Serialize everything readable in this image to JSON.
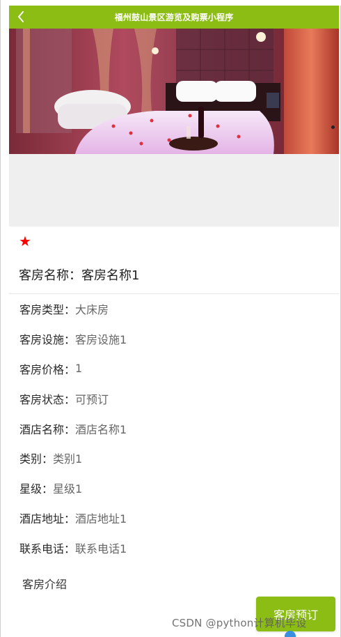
{
  "nav": {
    "title": "福州鼓山景区游览及购票小程序",
    "back_icon": "chevron-left-icon"
  },
  "banner": {
    "image": "hotel room photo: double bed with rose petals, wine bottle and glasses, bathtub on the left, red curtains"
  },
  "rating": {
    "icon": "star-icon",
    "color": "#ff0000"
  },
  "room": {
    "name_label": "客房名称：",
    "name_value": "客房名称1"
  },
  "details": [
    {
      "label": "客房类型：",
      "value": "大床房"
    },
    {
      "label": "客房设施：",
      "value": "客房设施1"
    },
    {
      "label": "客房价格：",
      "value": "1"
    },
    {
      "label": "客房状态：",
      "value": "可预订"
    },
    {
      "label": "酒店名称：",
      "value": "酒店名称1"
    },
    {
      "label": "类别：",
      "value": "类别1"
    },
    {
      "label": "星级：",
      "value": "星级1"
    },
    {
      "label": "酒店地址：",
      "value": "酒店地址1"
    },
    {
      "label": "联系电话：",
      "value": "联系电话1"
    }
  ],
  "intro": {
    "label": "客房介绍"
  },
  "actions": {
    "book_label": "客房预订"
  },
  "watermark": "CSDN @python计算机毕设",
  "colors": {
    "accent": "#8bbd14",
    "star": "#ff0000"
  }
}
